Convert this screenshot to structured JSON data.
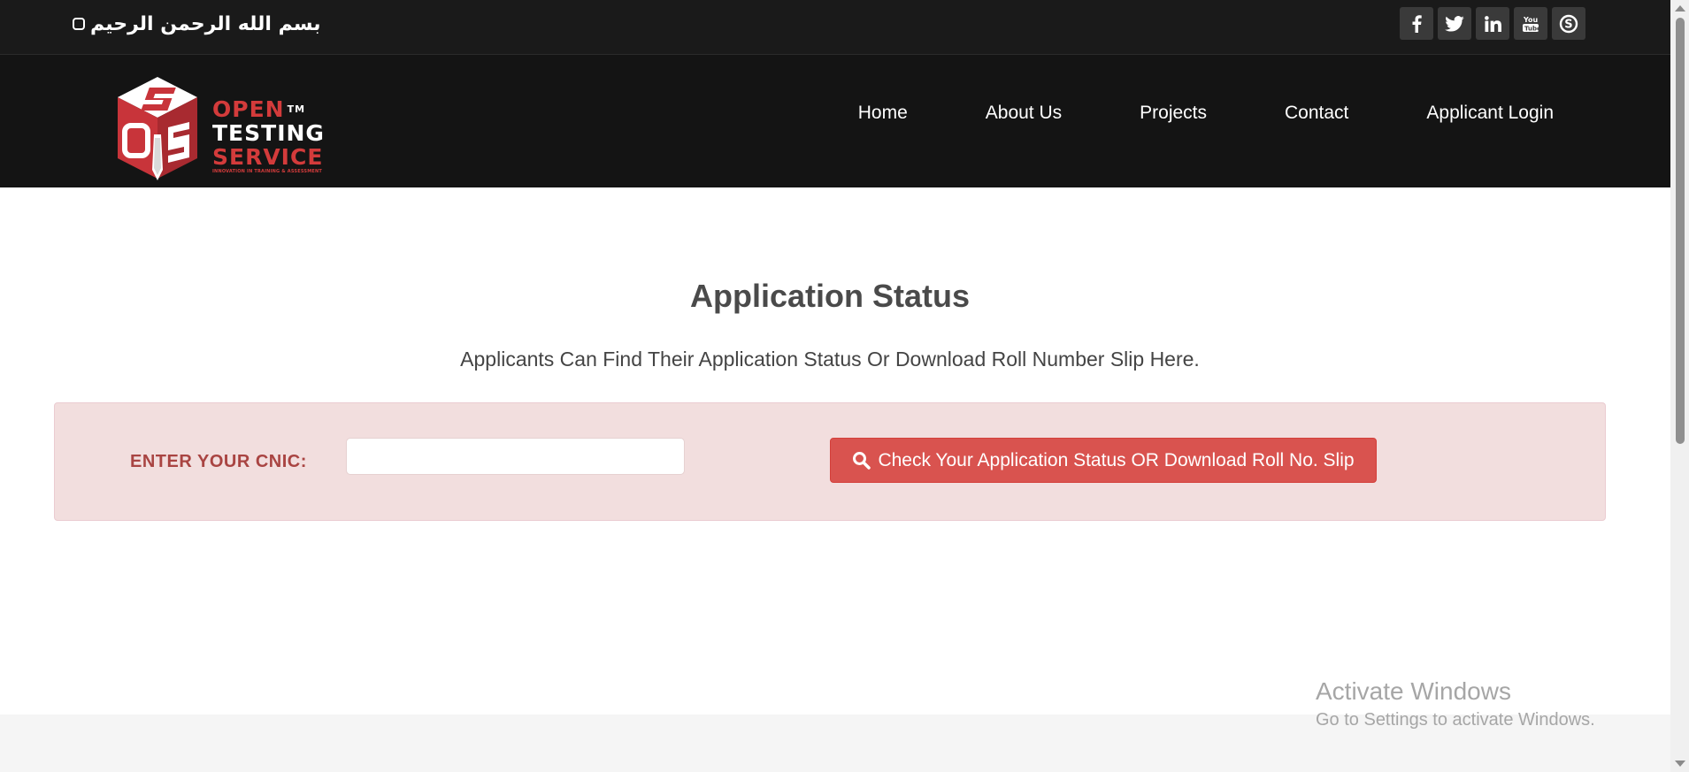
{
  "topbar": {
    "bismillah": "بسم الله الرحمن الرحيم",
    "social": [
      {
        "name": "facebook",
        "glyph": "f"
      },
      {
        "name": "twitter",
        "glyph": "t"
      },
      {
        "name": "linkedin",
        "glyph": "in"
      },
      {
        "name": "youtube",
        "glyph": "You"
      },
      {
        "name": "skype",
        "glyph": "S"
      }
    ]
  },
  "header": {
    "logo": {
      "open": "OPEN",
      "tm": "TM",
      "testing": "TESTING",
      "service": "SERVICE",
      "tagline": "INNOVATION IN TRAINING & ASSESSMENT",
      "mark_letters": "OTS"
    },
    "nav": [
      "Home",
      "About Us",
      "Projects",
      "Contact",
      "Applicant Login"
    ]
  },
  "main": {
    "title": "Application Status",
    "subtitle": "Applicants Can Find Their Application Status Or Download Roll Number Slip Here.",
    "form": {
      "cnic_label": "ENTER YOUR CNIC:",
      "cnic_value": "",
      "button_label": "Check Your Application Status OR Download Roll No. Slip"
    }
  },
  "watermark": {
    "title": "Activate Windows",
    "subtitle": "Go to Settings to activate Windows."
  },
  "colors": {
    "topbar_bg": "#1a1a1a",
    "header_bg": "#141414",
    "brand_red": "#d33b3b",
    "panel_bg": "#f2dede",
    "label_red": "#a94442",
    "button_red": "#d9534f"
  }
}
